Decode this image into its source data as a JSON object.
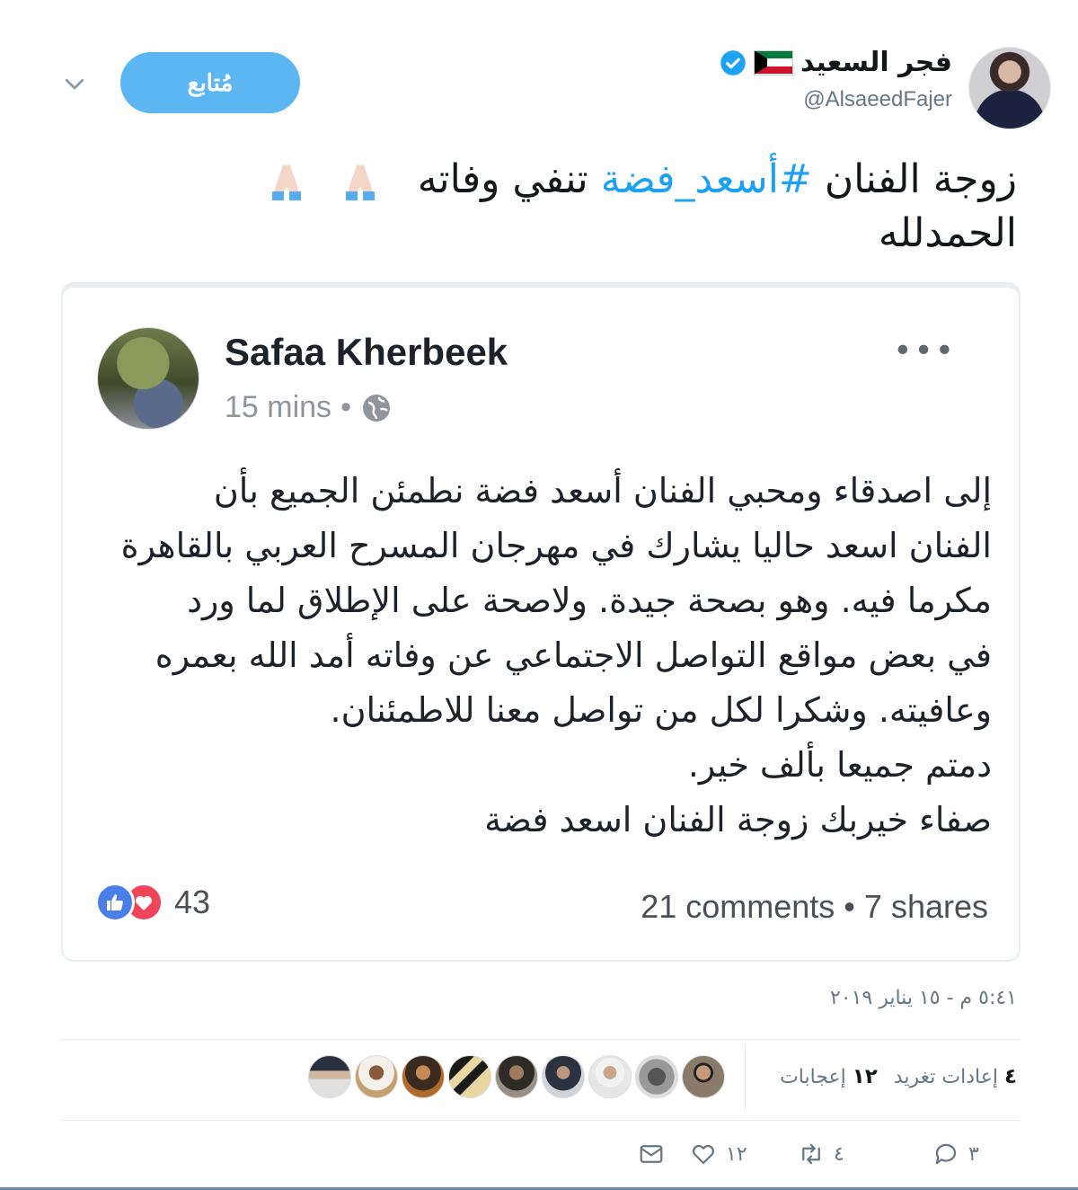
{
  "tweet": {
    "display_name": "فجر السعيد",
    "handle": "@AlsaeedFajer",
    "follow_label": "مُتابع",
    "text_line1_before": "زوجة الفنان ",
    "hashtag": "#أسعد_فضة",
    "text_line1_after": " تنفي وفاته",
    "text_line2": "الحمدلله",
    "timestamp": "٥:٤١ م - ١٥ يناير ٢٠١٩",
    "retweets_count": "٤",
    "retweets_label": "إعادات تغريد",
    "likes_count": "١٢",
    "likes_label": "إعجابات",
    "actions": {
      "reply_count": "٣",
      "retweet_count": "٤",
      "like_count": "١٢"
    }
  },
  "embedded_post": {
    "author": "Safaa Kherbeek",
    "time": "15 mins",
    "dot": "•",
    "more": "•••",
    "body_lines": [
      "إلى اصدقاء ومحبي الفنان أسعد فضة نطمئن الجميع بأن",
      "الفنان اسعد حاليا يشارك في مهرجان المسرح العربي بالقاهرة",
      "مكرما فيه. وهو بصحة جيدة.  ولاصحة على الإطلاق لما ورد",
      "في بعض مواقع التواصل الاجتماعي عن وفاته أمد الله بعمره",
      "وعافيته. وشكرا لكل من تواصل معنا للاطمئنان.",
      "دمتم جميعا بألف خير.",
      "صفاء خيربك زوجة الفنان اسعد فضة"
    ],
    "reactions_count": "43",
    "stats": "21 comments • 7 shares"
  },
  "colors": {
    "accent": "#1da1f2",
    "follow_button": "#5cb6f2",
    "muted": "#657786",
    "fb_like": "#4a7fe8",
    "fb_love": "#f0445a"
  },
  "icons": {
    "verified": "verified-badge-icon",
    "flag": "kuwait-flag-icon",
    "chevron": "chevron-down-icon",
    "pray": "folded-hands-icon",
    "globe": "globe-icon",
    "reply": "reply-icon",
    "retweet": "retweet-icon",
    "like": "heart-icon",
    "dm": "envelope-icon"
  }
}
